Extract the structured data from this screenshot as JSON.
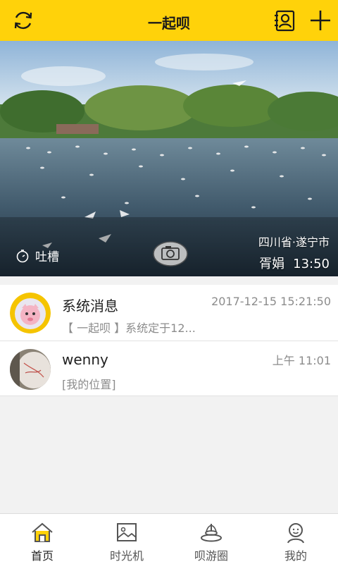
{
  "header": {
    "title": "一起呗",
    "refresh_icon": "refresh-icon",
    "contacts_icon": "contacts-icon",
    "add_icon": "plus-icon",
    "color": "#ffd20a"
  },
  "banner": {
    "tucao_label": "吐槽",
    "location": "四川省·遂宁市",
    "author": "胥娟",
    "time": "13:50"
  },
  "messages": [
    {
      "name": "系统消息",
      "time": "2017-12-15 15:21:50",
      "preview": "【 一起呗 】系统定于12..."
    },
    {
      "name": "wenny",
      "time": "上午 11:01",
      "preview": "[我的位置]"
    }
  ],
  "tabs": [
    {
      "label": "首页",
      "icon": "home-icon",
      "active": true
    },
    {
      "label": "时光机",
      "icon": "picture-icon"
    },
    {
      "label": "呗游圈",
      "icon": "fountain-icon"
    },
    {
      "label": "我的",
      "icon": "person-icon"
    }
  ]
}
